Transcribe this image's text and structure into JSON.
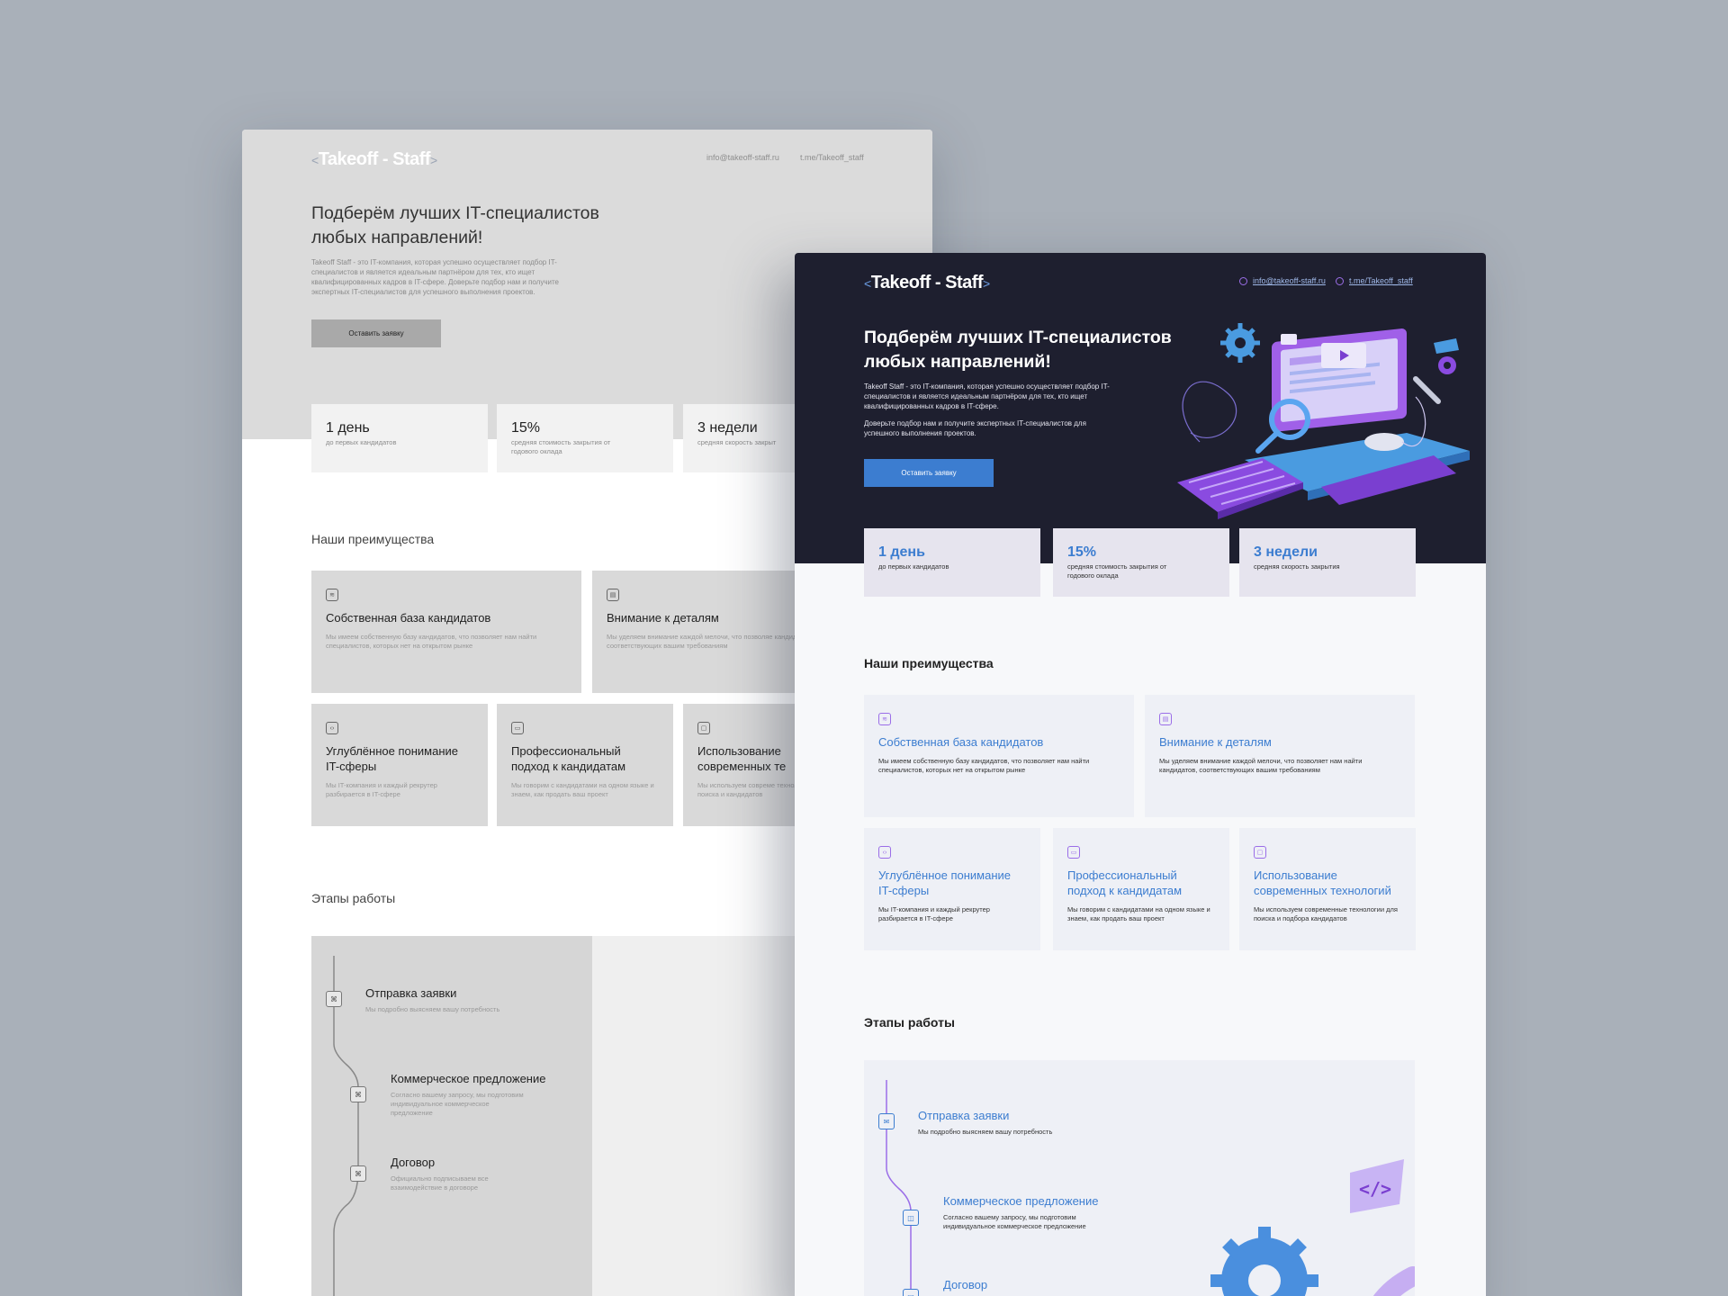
{
  "brand": {
    "name": "Takeoff - Staff",
    "bracket_left": "<",
    "bracket_right": ">"
  },
  "contacts": {
    "email": "info@takeoff-staff.ru",
    "telegram": "t.me/Takeoff_staff"
  },
  "hero": {
    "title": "Подберём лучших IT-специалистов любых направлений!",
    "desc_full": "Takeoff Staff - это IT-компания, которая успешно осуществляет подбор IT-специалистов и является идеальным партнёром для тех, кто ищет квалифицированных кадров в IT-сфере. Доверьте подбор нам и получите экспертных IT-специалистов для успешного выполнения проектов.",
    "desc_p1": "Takeoff Staff - это IT-компания, которая успешно осуществляет подбор IT-специалистов и является идеальным партнёром для тех, кто ищет квалифицированных кадров в IT-сфере.",
    "desc_p2": "Доверьте подбор нам и получите экспертных IT-специалистов для успешного выполнения проектов.",
    "cta": "Оставить заявку"
  },
  "stats": [
    {
      "value": "1 день",
      "label": "до первых кандидатов"
    },
    {
      "value": "15%",
      "label": "средняя стоимость закрытия от годового оклада"
    },
    {
      "value": "3 недели",
      "label": "средняя скорость закрытия"
    }
  ],
  "wf_stat3_label": "средняя скорость закрыт",
  "advantages": {
    "title": "Наши преимущества",
    "items": [
      {
        "title": "Собственная база кандидатов",
        "desc": "Мы имеем собственную базу кандидатов, что позволяет нам найти специалистов, которых нет на открытом рынке"
      },
      {
        "title": "Внимание к деталям",
        "desc": "Мы уделяем внимание каждой мелочи, что позволяет нам найти кандидатов, соответствующих вашим требованиям"
      },
      {
        "title": "Углублённое понимание IT-сферы",
        "desc": "Мы IT-компания и каждый рекрутер разбирается в IT-сфере"
      },
      {
        "title": "Профессиональный подход к кандидатам",
        "desc": "Мы говорим с кандидатами на одном языке и знаем, как продать ваш проект"
      },
      {
        "title": "Использование современных технологий",
        "desc": "Мы используем современные технологии для поиска и подбора кандидатов"
      }
    ],
    "wf_cut": {
      "item2_desc": "Мы уделяем внимание каждой мелочи, что позволяе кандидатов, соответствующих вашим требованиям",
      "item5_title": "Использование современных те",
      "item5_desc": "Мы используем совреме технологии для поиска и кандидатов"
    }
  },
  "stages": {
    "title": "Этапы работы",
    "items": [
      {
        "title": "Отправка заявки",
        "desc": "Мы подробно выясняем вашу потребность"
      },
      {
        "title": "Коммерческое предложение",
        "desc": "Согласно вашему запросу, мы подготовим индивидуальное коммерческое предложение"
      },
      {
        "title": "Договор",
        "desc": "Официально подписываем все взаимодействие в договоре"
      }
    ]
  },
  "colors": {
    "accent_blue": "#3c7dd0",
    "accent_purple": "#9b6ee8",
    "hero_dark": "#1e1f2f",
    "backdrop": "#a9b0b9"
  },
  "icons": {
    "adv": [
      "database-icon",
      "detail-icon",
      "code-icon",
      "briefcase-icon",
      "laptop-icon"
    ],
    "steps": [
      "mail-icon",
      "chat-icon",
      "document-icon"
    ]
  }
}
